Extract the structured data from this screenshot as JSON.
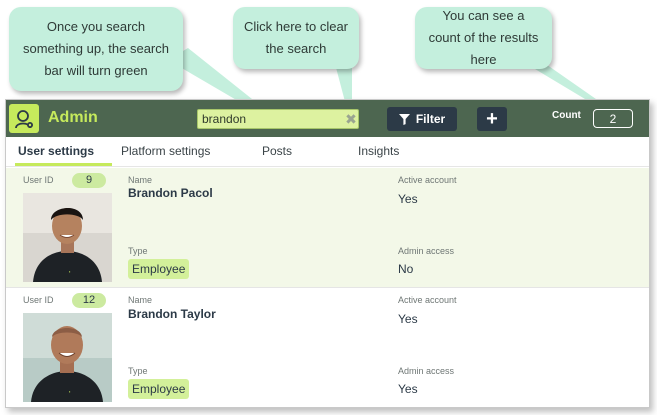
{
  "callouts": {
    "search_tip": "Once you search something up, the search bar will turn green",
    "clear_tip": "Click here to clear the search",
    "count_tip": "You can see a count of the results here"
  },
  "header": {
    "title": "Admin",
    "search_value": "brandon",
    "clear_glyph": "✖",
    "filter_label": "Filter",
    "add_label": "+",
    "count_label": "Count",
    "count_value": "2"
  },
  "tabs": [
    {
      "label": "User settings",
      "active": true
    },
    {
      "label": "Platform settings",
      "active": false
    },
    {
      "label": "Posts",
      "active": false
    },
    {
      "label": "Insights",
      "active": false
    }
  ],
  "labels": {
    "user_id": "User ID",
    "name": "Name",
    "type": "Type",
    "active_account": "Active account",
    "admin_access": "Admin access"
  },
  "users": [
    {
      "id": "9",
      "name": "Brandon Pacol",
      "type": "Employee",
      "active_account": "Yes",
      "admin_access": "No"
    },
    {
      "id": "12",
      "name": "Brandon Taylor",
      "type": "Employee",
      "active_account": "Yes",
      "admin_access": "Yes"
    }
  ],
  "colors": {
    "header_bg": "#4d6650",
    "accent": "#c6ea5c",
    "search_bg": "#ddf2a0",
    "button_bg": "#2c3a47",
    "callout_bg": "#c4efdd",
    "selected_row_bg": "#f3f8e8"
  },
  "icons": {
    "logo": "admin-user-gear-icon",
    "filter": "funnel-icon",
    "clear": "close-icon"
  }
}
